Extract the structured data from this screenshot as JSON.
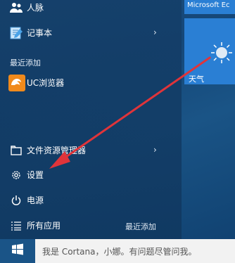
{
  "menu": {
    "contacts_label": "人脉",
    "notepad_label": "记事本",
    "recently_added_header": "最近添加",
    "uc_browser_label": "UC浏览器",
    "file_explorer_label": "文件资源管理器",
    "settings_label": "设置",
    "power_label": "电源",
    "all_apps_label": "所有应用",
    "all_apps_hint": "最近添加"
  },
  "tiles": {
    "edge_label": "Microsoft Ec",
    "weather_label": "天气"
  },
  "taskbar": {
    "search_placeholder": "我是 Cortana，小娜。有问题尽管问我。"
  },
  "colors": {
    "tile_blue": "#2a7fd4",
    "arrow_red": "#e0343a",
    "uc_orange": "#f08a1c"
  }
}
